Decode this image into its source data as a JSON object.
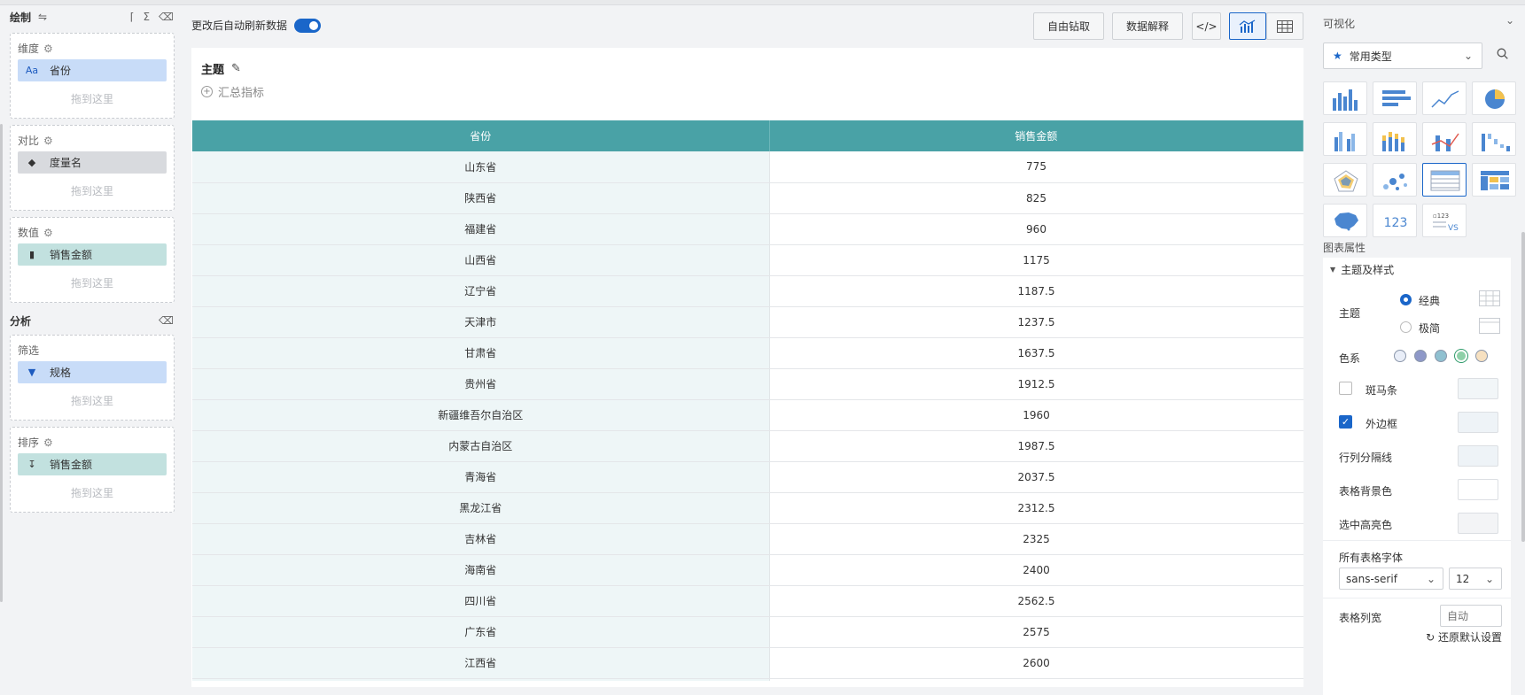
{
  "left": {
    "draw_title": "绘制",
    "wells": [
      {
        "title": "维度",
        "pill": "省份",
        "pill_icon": "Aa",
        "drop": "拖到这里"
      },
      {
        "title": "对比",
        "pill": "度量名",
        "pill_icon": "tag-icon",
        "drop": "拖到这里"
      },
      {
        "title": "数值",
        "pill": "销售金额",
        "pill_icon": "bar-chart-icon",
        "drop": "拖到这里"
      }
    ],
    "analysis_title": "分析",
    "analysis_wells": [
      {
        "title": "筛选",
        "pill": "规格",
        "pill_icon": "filter-icon",
        "drop": "拖到这里"
      },
      {
        "title": "排序",
        "pill": "销售金额",
        "pill_icon": "sort-icon",
        "drop": "拖到这里"
      }
    ]
  },
  "toolbar": {
    "auto_refresh": "更改后自动刷新数据",
    "drill": "自由钻取",
    "explain": "数据解释"
  },
  "card": {
    "title": "主题",
    "summary": "汇总指标"
  },
  "table": {
    "headers": [
      "省份",
      "销售金额"
    ],
    "rows": [
      [
        "山东省",
        "775"
      ],
      [
        "陕西省",
        "825"
      ],
      [
        "福建省",
        "960"
      ],
      [
        "山西省",
        "1175"
      ],
      [
        "辽宁省",
        "1187.5"
      ],
      [
        "天津市",
        "1237.5"
      ],
      [
        "甘肃省",
        "1637.5"
      ],
      [
        "贵州省",
        "1912.5"
      ],
      [
        "新疆维吾尔自治区",
        "1960"
      ],
      [
        "内蒙古自治区",
        "1987.5"
      ],
      [
        "青海省",
        "2037.5"
      ],
      [
        "黑龙江省",
        "2312.5"
      ],
      [
        "吉林省",
        "2325"
      ],
      [
        "海南省",
        "2400"
      ],
      [
        "四川省",
        "2562.5"
      ],
      [
        "广东省",
        "2575"
      ],
      [
        "江西省",
        "2600"
      ],
      [
        "",
        ""
      ]
    ]
  },
  "right": {
    "viz_title": "可视化",
    "type_select": "常用类型",
    "props_title": "图表属性",
    "section": "主题及样式",
    "theme_label": "主题",
    "theme_classic": "经典",
    "theme_minimal": "极简",
    "color_label": "色系",
    "zebra": "斑马条",
    "border": "外边框",
    "gridlines": "行列分隔线",
    "bg": "表格背景色",
    "highlight": "选中高亮色",
    "font_label": "所有表格字体",
    "font_value": "sans-serif",
    "font_size": "12",
    "col_width_label": "表格列宽",
    "col_width_placeholder": "自动",
    "reset": "还原默认设置",
    "accent": "#1a66c9",
    "palette": [
      "#e9eef8",
      "#8e98c8",
      "#8fc0d0",
      "#8ed0a8",
      "#f6e0c0"
    ]
  }
}
